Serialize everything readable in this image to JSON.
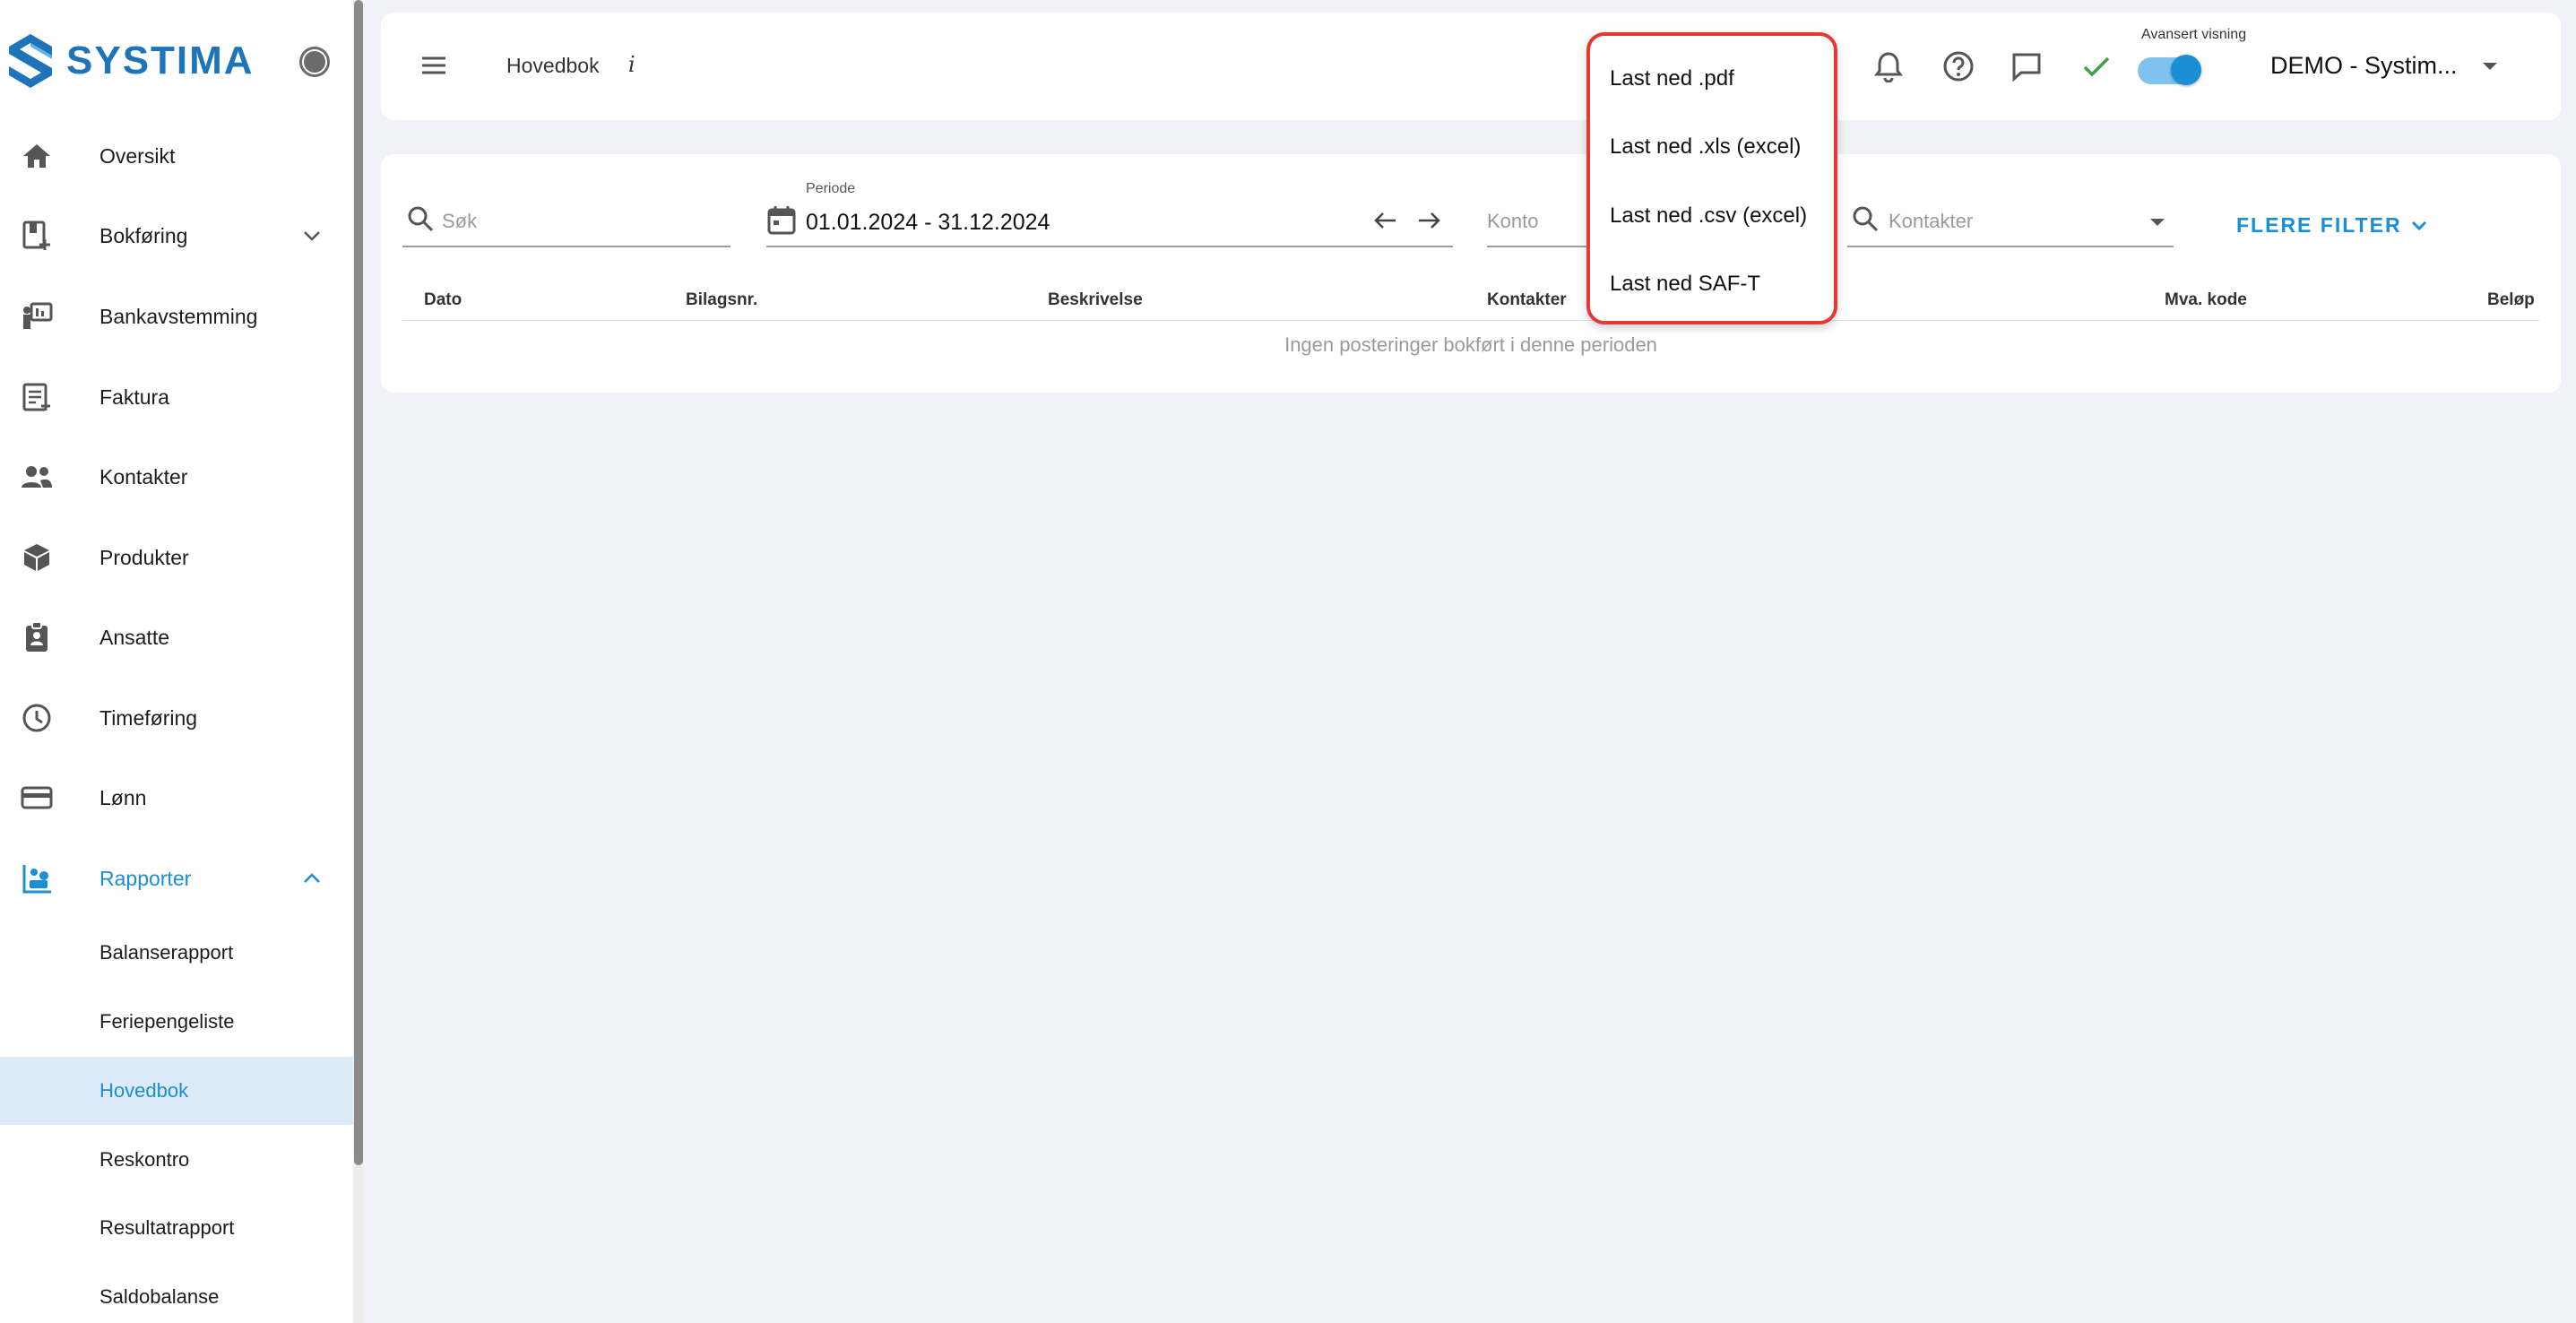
{
  "brand": {
    "name": "SYSTIMA",
    "accent": "#1a8fd6",
    "logo_color": "#1d74b8"
  },
  "sidebar": {
    "items": [
      {
        "label": "Oversikt",
        "icon": "home-icon"
      },
      {
        "label": "Bokføring",
        "icon": "bookkeeping-icon",
        "expandable": true,
        "expanded": false
      },
      {
        "label": "Bankavstemming",
        "icon": "bank-reconciliation-icon"
      },
      {
        "label": "Faktura",
        "icon": "invoice-icon"
      },
      {
        "label": "Kontakter",
        "icon": "contacts-icon"
      },
      {
        "label": "Produkter",
        "icon": "product-box-icon"
      },
      {
        "label": "Ansatte",
        "icon": "employee-badge-icon"
      },
      {
        "label": "Timeføring",
        "icon": "clock-icon"
      },
      {
        "label": "Lønn",
        "icon": "payroll-card-icon"
      },
      {
        "label": "Rapporter",
        "icon": "reports-icon",
        "expandable": true,
        "expanded": true,
        "active": true
      }
    ],
    "report_subitems": [
      {
        "label": "Balanserapport"
      },
      {
        "label": "Feriepengeliste"
      },
      {
        "label": "Hovedbok",
        "selected": true
      },
      {
        "label": "Reskontro"
      },
      {
        "label": "Resultatrapport"
      },
      {
        "label": "Saldobalanse"
      }
    ]
  },
  "topbar": {
    "title": "Hovedbok",
    "info_symbol": "i",
    "advanced_view_label": "Avansert visning",
    "advanced_view_on": true,
    "company": "DEMO - Systim..."
  },
  "filters": {
    "search_placeholder": "Søk",
    "period_label": "Periode",
    "period_value": "01.01.2024 - 31.12.2024",
    "account_placeholder": "Konto",
    "contacts_placeholder": "Kontakter",
    "more_filters_label": "FLERE FILTER"
  },
  "table": {
    "columns": [
      "Dato",
      "Bilagsnr.",
      "Beskrivelse",
      "Kontakter",
      "Mva. kode",
      "Beløp"
    ],
    "empty_message": "Ingen posteringer bokført i denne perioden"
  },
  "export_menu": {
    "items": [
      "Last ned .pdf",
      "Last ned .xls (excel)",
      "Last ned .csv (excel)",
      "Last ned SAF-T"
    ],
    "highlight_color": "#e53935"
  }
}
